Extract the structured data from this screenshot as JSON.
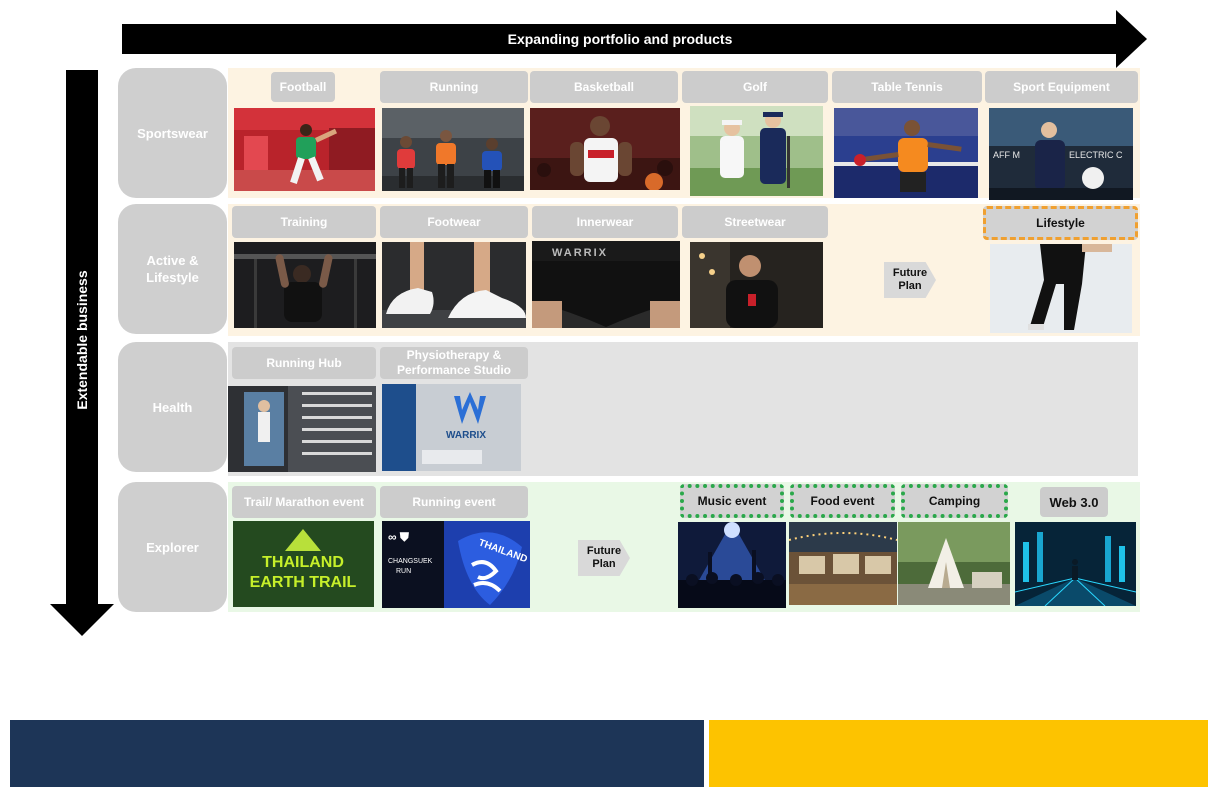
{
  "header": {
    "portfolio_arrow": "Expanding portfolio and products"
  },
  "side": {
    "business_arrow": "Extendable business"
  },
  "rows": {
    "sportswear": "Sportswear",
    "active": "Active & Lifestyle",
    "health": "Health",
    "explorer": "Explorer"
  },
  "sportswear_items": [
    "Football",
    "Running",
    "Basketball",
    "Golf",
    "Table Tennis",
    "Sport Equipment"
  ],
  "active_items": [
    "Training",
    "Footwear",
    "Innerwear",
    "Streetwear",
    "Lifestyle"
  ],
  "health_items": [
    "Running Hub",
    "Physiotherapy & Performance Studio"
  ],
  "explorer_items": [
    "Trail/ Marathon event",
    "Running event",
    "Music event",
    "Food event",
    "Camping",
    "Web 3.0"
  ],
  "future_plan": "Future Plan",
  "image_text": {
    "warrix_band": "WARRIX",
    "trail_line1": "THAILAND",
    "trail_line2": "EARTH TRAIL",
    "chang_line1": "CHANGSUEK",
    "chang_line2": "RUN",
    "thailand": "THAILAND",
    "affm": "AFF M",
    "electric": "ELECTRIC C",
    "studio_logo": "WARRIX"
  },
  "colors": {
    "band_warm": "#fdf3e2",
    "band_gray": "#e3e3e3",
    "band_green": "#e9f8e6",
    "navy": "#1d3557",
    "yellow": "#fdc300",
    "dash_orange": "#f0a030",
    "dash_green": "#2aa84a"
  }
}
